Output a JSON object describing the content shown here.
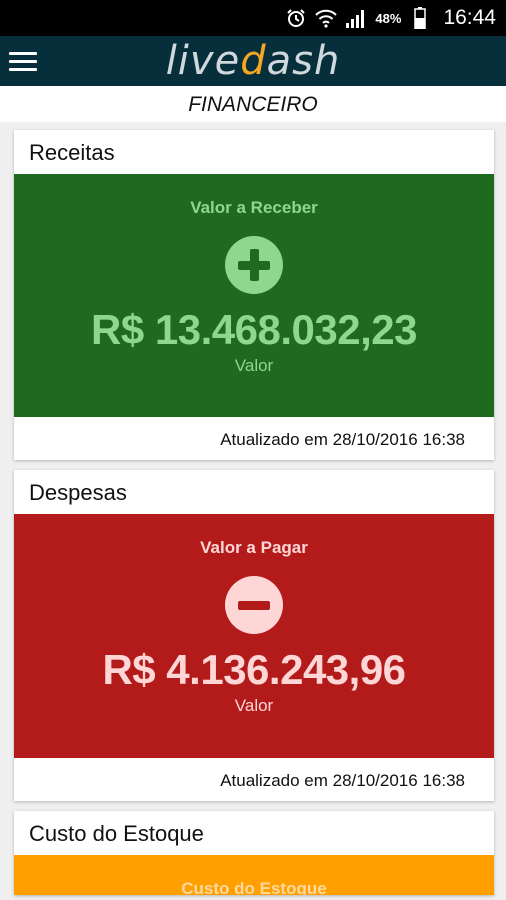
{
  "status_bar": {
    "battery_percent": "48%",
    "time": "16:44"
  },
  "app_bar": {
    "logo_left": "live",
    "logo_mark": "d",
    "logo_right": "ash"
  },
  "page": {
    "title": "FINANCEIRO"
  },
  "cards": [
    {
      "header": "Receitas",
      "subtitle": "Valor a Receber",
      "icon": "plus-circle-icon",
      "amount": "R$ 13.468.032,23",
      "caption": "Valor",
      "footer": "Atualizado em 28/10/2016 16:38",
      "color": "#1e6a1f"
    },
    {
      "header": "Despesas",
      "subtitle": "Valor a Pagar",
      "icon": "minus-circle-icon",
      "amount": "R$ 4.136.243,96",
      "caption": "Valor",
      "footer": "Atualizado em 28/10/2016 16:38",
      "color": "#b31b1b"
    },
    {
      "header": "Custo do Estoque",
      "subtitle": "Custo do Estoque",
      "color": "#ffa000"
    }
  ]
}
